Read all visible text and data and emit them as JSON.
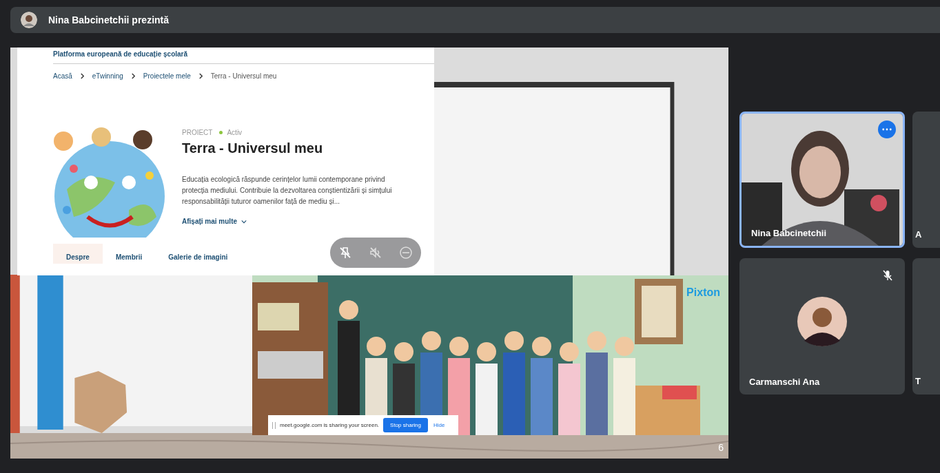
{
  "header": {
    "title": "Nina Babcinetchii prezintă"
  },
  "shared_page": {
    "site_title": "Platforma europeană de educație școlară",
    "breadcrumbs": [
      {
        "label": "Acasă",
        "link": true
      },
      {
        "label": "eTwinning",
        "link": true
      },
      {
        "label": "Proiectele mele",
        "link": true
      },
      {
        "label": "Terra - Universul meu",
        "link": false
      }
    ],
    "eyebrow": "PROIECT",
    "status": "Activ",
    "title": "Terra - Universul meu",
    "description": "Educația ecologică răspunde cerințelor lumii contemporane privind protecția mediului. Contribuie la dezvoltarea conștientizării și simțului responsabilității tuturor oamenilor față de mediu și...",
    "more_link": "Afișați mai multe",
    "tabs": [
      {
        "label": "Despre",
        "selected": true
      },
      {
        "label": "Membrii",
        "selected": false
      },
      {
        "label": "Galerie de imagini",
        "selected": false
      }
    ]
  },
  "comic": {
    "brand": "Pixton"
  },
  "share_bar": {
    "message": "meet.google.com is sharing your screen.",
    "stop": "Stop sharing",
    "hide": "Hide"
  },
  "page_number": "6",
  "participants": [
    {
      "name": "Nina Babcinetchii",
      "kind": "video",
      "selected": true,
      "muted": false
    },
    {
      "name": "Carmanschi Ana",
      "kind": "avatar",
      "selected": false,
      "muted": true
    }
  ],
  "edge_tiles": [
    {
      "label": "A"
    },
    {
      "label": "T"
    }
  ]
}
